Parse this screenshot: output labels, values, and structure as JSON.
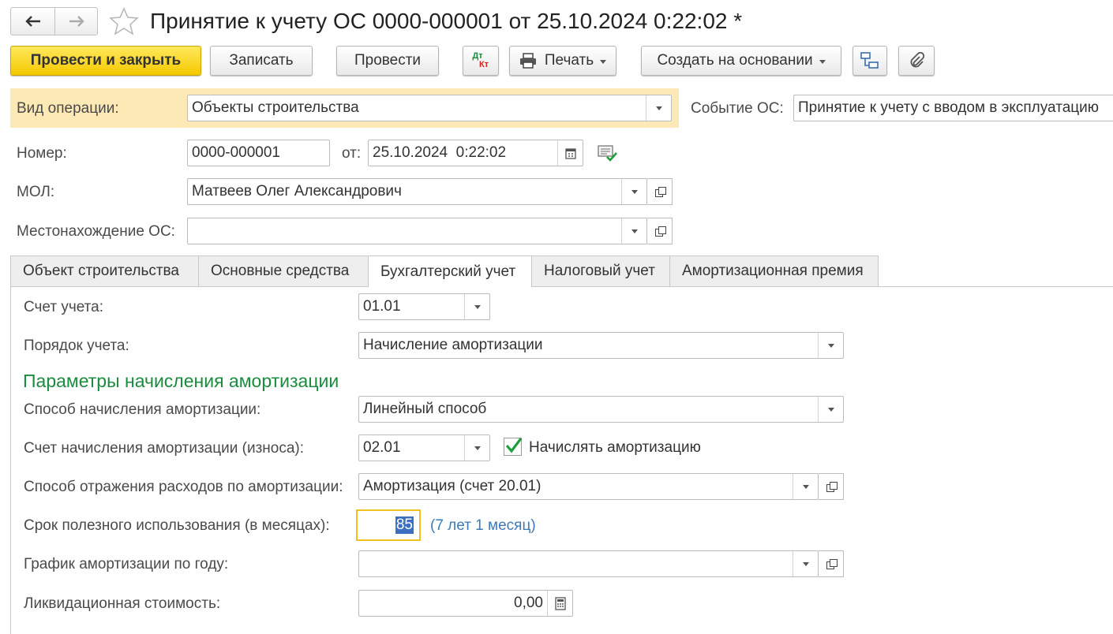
{
  "window": {
    "title": "Принятие к учету ОС 0000-000001 от 25.10.2024 0:22:02 *"
  },
  "toolbar": {
    "post_close": "Провести и закрыть",
    "save": "Записать",
    "post": "Провести",
    "dtkt_top": "Дт",
    "dtkt_bottom": "Кт",
    "print": "Печать",
    "create_based": "Создать на основании"
  },
  "header": {
    "operation_label": "Вид операции:",
    "operation_value": "Объекты строительства",
    "event_label": "Событие ОС:",
    "event_value": "Принятие к учету с вводом в эксплуатацию",
    "number_label": "Номер:",
    "number_value": "0000-000001",
    "date_label": "от:",
    "date_value": "25.10.2024  0:22:02",
    "mol_label": "МОЛ:",
    "mol_value": "Матвеев Олег Александрович",
    "location_label": "Местонахождение ОС:",
    "location_value": ""
  },
  "tabs": [
    {
      "label": "Объект строительства"
    },
    {
      "label": "Основные средства"
    },
    {
      "label": "Бухгалтерский учет"
    },
    {
      "label": "Налоговый учет"
    },
    {
      "label": "Амортизационная премия"
    }
  ],
  "active_tab": "Бухгалтерский учет",
  "accounting": {
    "account_label": "Счет учета:",
    "account_value": "01.01",
    "order_label": "Порядок учета:",
    "order_value": "Начисление амортизации",
    "section_title": "Параметры начисления амортизации",
    "method_label": "Способ начисления амортизации:",
    "method_value": "Линейный способ",
    "dep_account_label": "Счет начисления амортизации (износа):",
    "dep_account_value": "02.01",
    "accrue_checkbox_label": "Начислять амортизацию",
    "accrue_checked": true,
    "expense_label": "Способ отражения расходов по амортизации:",
    "expense_value": "Амортизация (счет 20.01)",
    "life_label": "Срок полезного использования (в месяцах):",
    "life_value": "85",
    "life_hint": "(7 лет 1 месяц)",
    "schedule_label": "График амортизации по году:",
    "schedule_value": "",
    "liquidation_label": "Ликвидационная стоимость:",
    "liquidation_value": "0,00"
  },
  "colors": {
    "accent_yellow": "#f5c900",
    "operation_bg": "#fce9b5",
    "section_green": "#1a8c3e",
    "hint_blue": "#3d7ab8",
    "focus_border": "#f0c020"
  }
}
